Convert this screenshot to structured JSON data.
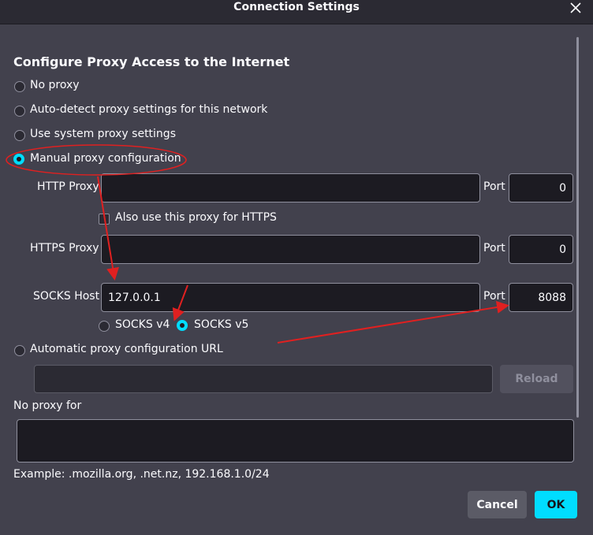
{
  "window": {
    "title": "Connection Settings",
    "close_icon": "close-icon"
  },
  "section_heading": "Configure Proxy Access to the Internet",
  "proxy_options": {
    "no_proxy": "No proxy",
    "auto_detect": "Auto-detect proxy settings for this network",
    "system": "Use system proxy settings",
    "manual": "Manual proxy configuration",
    "auto_url": "Automatic proxy configuration URL"
  },
  "selected_option": "manual",
  "http": {
    "label": "HTTP Proxy",
    "value": "",
    "port_label": "Port",
    "port": "0"
  },
  "also_https": {
    "label": "Also use this proxy for HTTPS",
    "checked": false
  },
  "https": {
    "label": "HTTPS Proxy",
    "value": "",
    "port_label": "Port",
    "port": "0"
  },
  "socks": {
    "label": "SOCKS Host",
    "value": "127.0.0.1",
    "port_label": "Port",
    "port": "8088",
    "v4_label": "SOCKS v4",
    "v5_label": "SOCKS v5",
    "selected_version": "v5"
  },
  "auto_url": {
    "value": "",
    "reload_label": "Reload"
  },
  "no_proxy_for": {
    "label": "No proxy for",
    "value": ""
  },
  "example_text": "Example: .mozilla.org, .net.nz, 192.168.1.0/24",
  "buttons": {
    "cancel": "Cancel",
    "ok": "OK"
  },
  "colors": {
    "accent": "#00ddff",
    "annotation": "#e02020",
    "background": "#42414d"
  }
}
